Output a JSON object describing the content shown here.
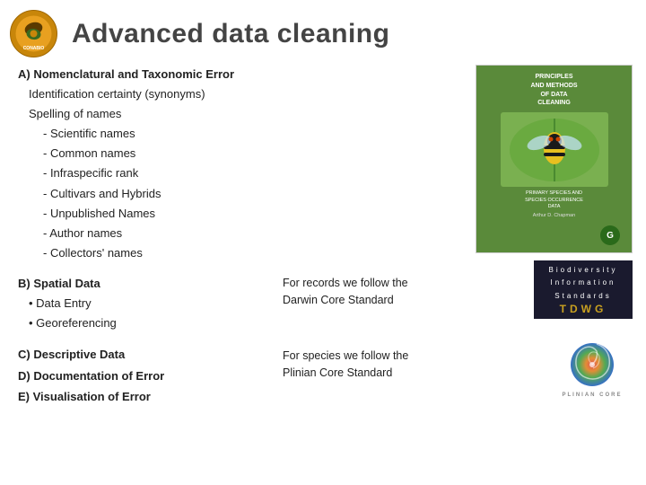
{
  "header": {
    "title": "Advanced data cleaning"
  },
  "sectionA": {
    "title": "A) Nomenclatural and Taxonomic Error",
    "bullets": [
      "Identification certainty (synonyms)",
      "Spelling of names"
    ],
    "subItems": [
      "Scientific names",
      "Common names",
      "Infraspecific rank",
      "Cultivars and Hybrids",
      "Unpublished Names",
      "Author names",
      "Collectors' names"
    ]
  },
  "sectionB": {
    "title": "B) Spatial Data",
    "bullets": [
      "Data Entry",
      "Georeferencing"
    ]
  },
  "sectionCDE": {
    "c": "C) Descriptive Data",
    "d": "D) Documentation of Error",
    "e": "E) Visualisation of Error"
  },
  "darwinText": {
    "line1": "For records we follow the",
    "line2": "Darwin Core Standard"
  },
  "plinianText": {
    "line1": "For species we follow the",
    "line2": "Plinian Core Standard"
  },
  "tdwg": {
    "line1": "Biodiversity",
    "line2": "Information",
    "line3": "Standards",
    "abbr": "TDWG"
  },
  "bookCover": {
    "title": "PRINCIPLES\nAND METHODS\nOF DATA\nCLEANING",
    "subtitle": "PRIMARY SPECIES AND\nSPECIES OCCURRENCE\nDATA",
    "publisher": "G"
  },
  "plinian_label": "PLINIAN CORE"
}
